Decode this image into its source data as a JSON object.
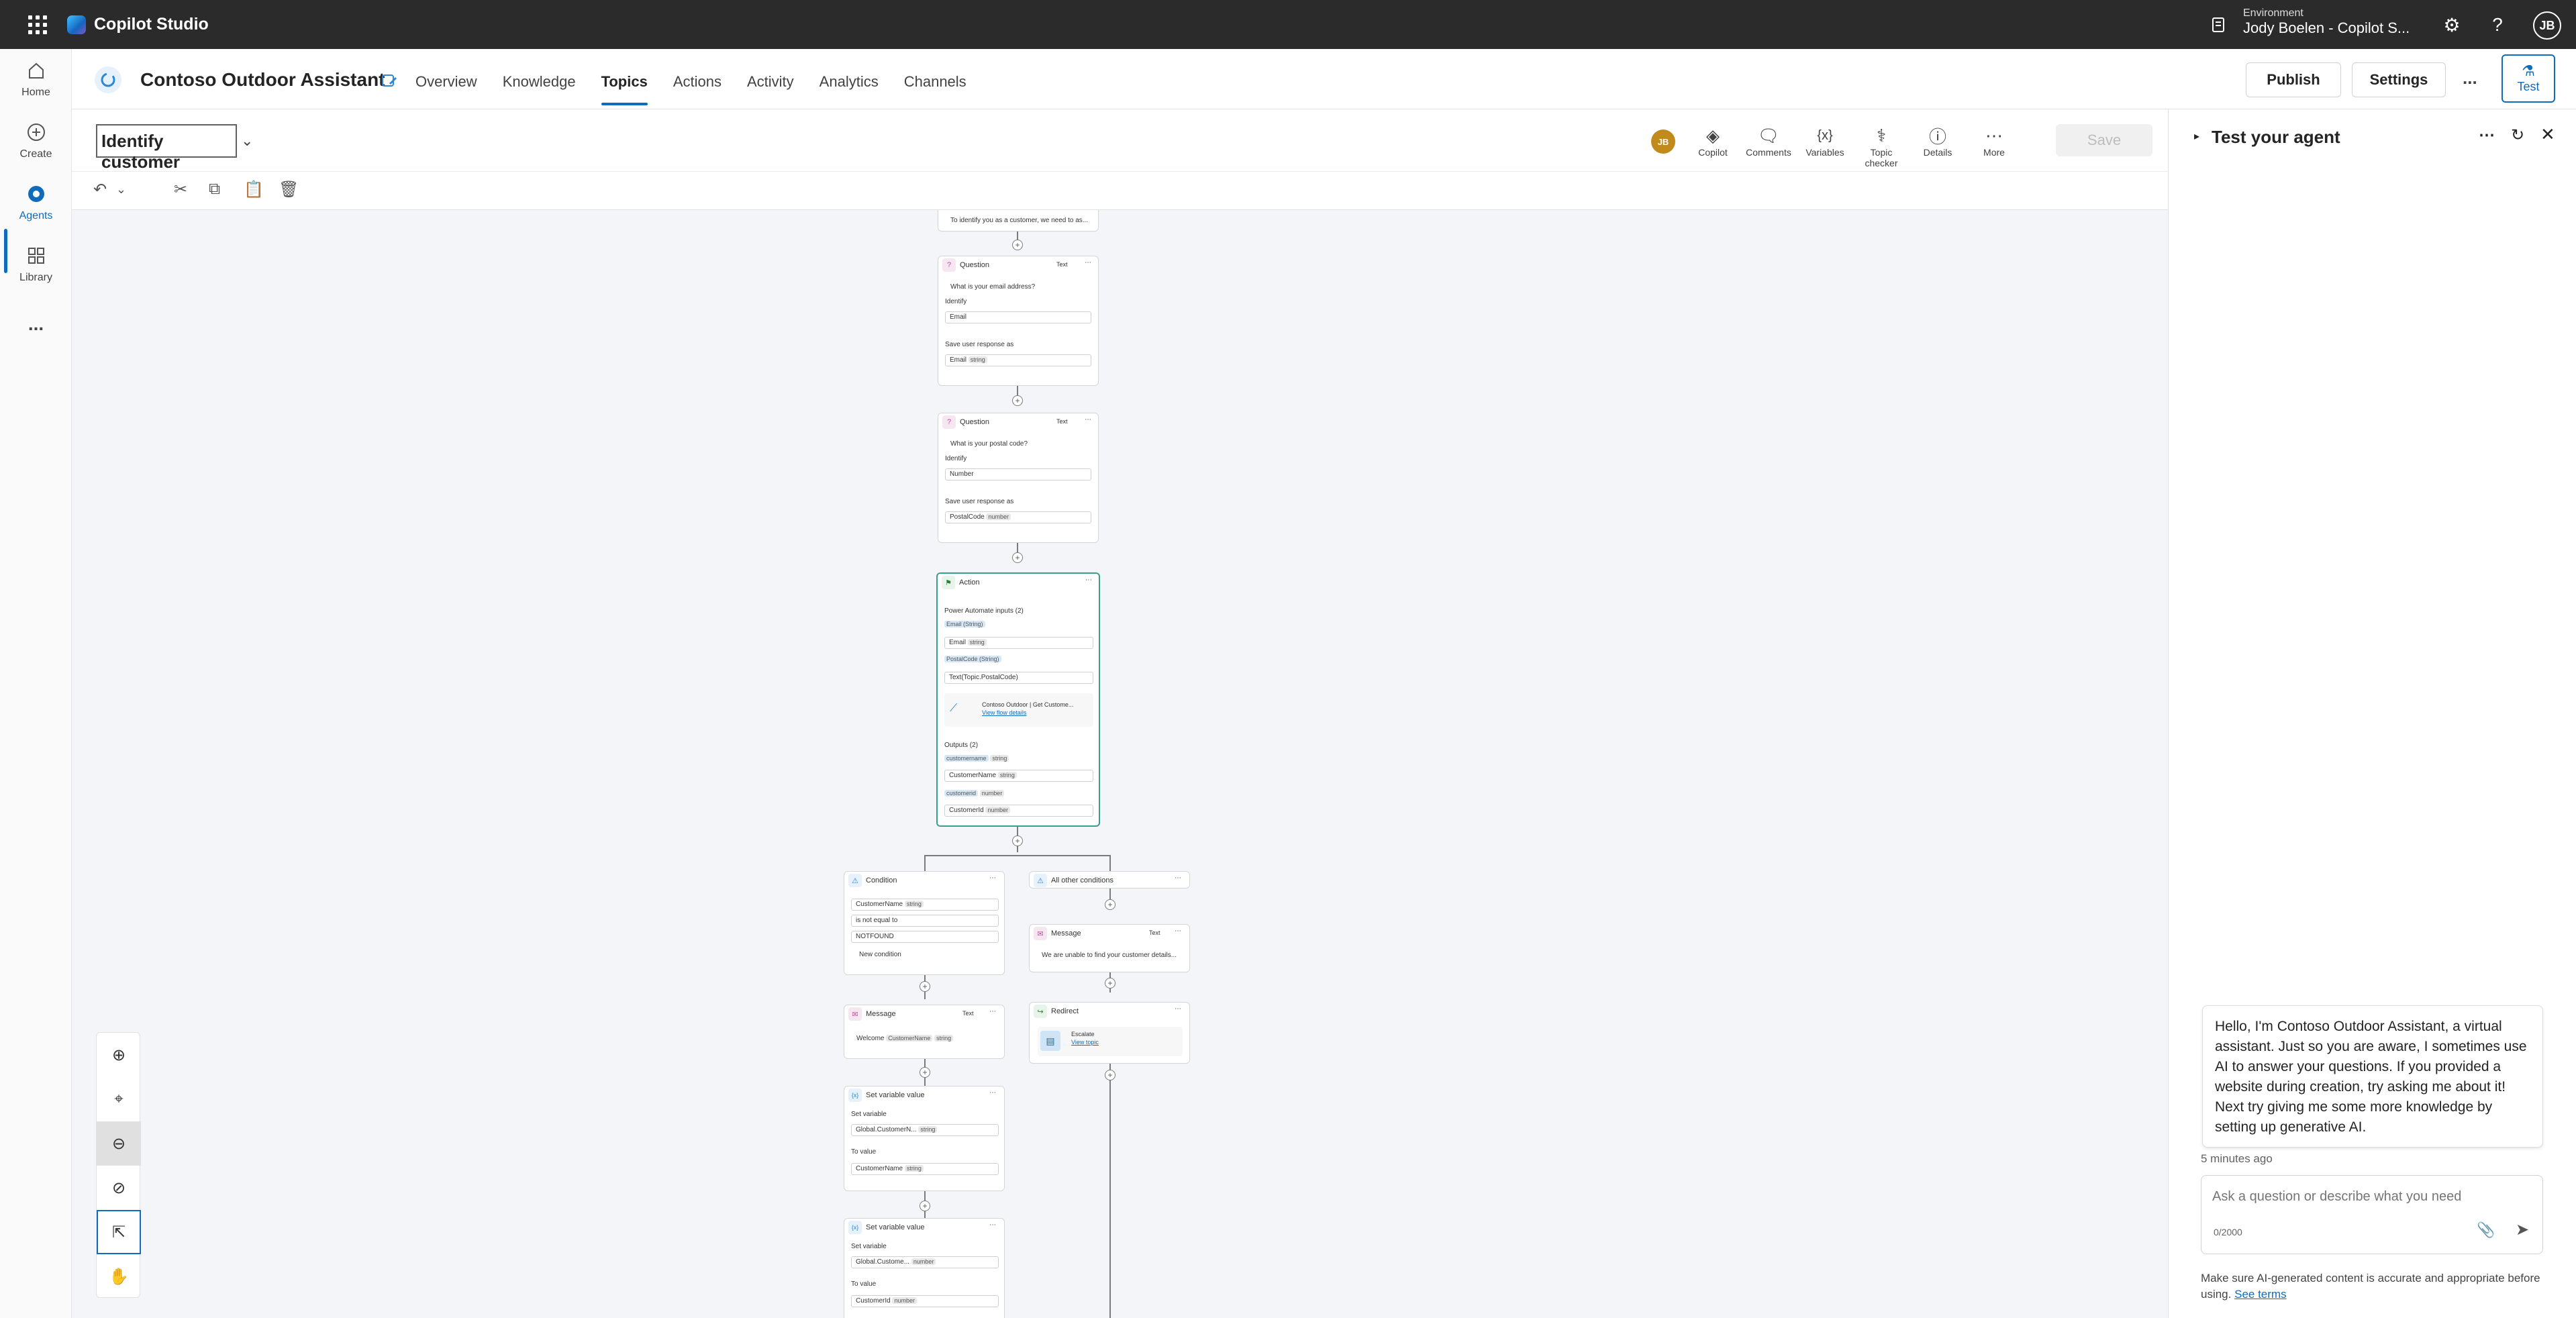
{
  "app": {
    "name": "Copilot Studio"
  },
  "environment": {
    "label": "Environment",
    "value": "Jody Boelen - Copilot S..."
  },
  "user": {
    "initials": "JB"
  },
  "rail": {
    "items": [
      {
        "label": "Home",
        "icon": "home-icon"
      },
      {
        "label": "Create",
        "icon": "plus-circle-icon"
      },
      {
        "label": "Agents",
        "icon": "agent-icon",
        "active": true
      },
      {
        "label": "Library",
        "icon": "library-icon"
      },
      {
        "label": "...",
        "icon": "more-icon"
      }
    ]
  },
  "agent": {
    "name": "Contoso Outdoor Assistant"
  },
  "nav": {
    "tabs": [
      "Overview",
      "Knowledge",
      "Topics",
      "Actions",
      "Activity",
      "Analytics",
      "Channels"
    ],
    "active": "Topics"
  },
  "header_buttons": {
    "publish": "Publish",
    "settings": "Settings",
    "more": "...",
    "test": "Test"
  },
  "topic": {
    "name": "Identify customer"
  },
  "toolbar": {
    "avatar": "JB",
    "copilot": "Copilot",
    "comments": "Comments",
    "variables": "Variables",
    "topic_checker": "Topic checker",
    "details": "Details",
    "more": "More",
    "save": "Save"
  },
  "flow": {
    "top_message": "To identify you as a customer, we need to as...",
    "q1": {
      "title": "Question",
      "mode": "Text",
      "prompt": "What is your email address?",
      "identify_label": "Identify",
      "identify": "Email",
      "save_label": "Save user response as",
      "var": "Email",
      "type": "string"
    },
    "q2": {
      "title": "Question",
      "mode": "Text",
      "prompt": "What is your postal code?",
      "identify_label": "Identify",
      "identify": "Number",
      "save_label": "Save user response as",
      "var": "PostalCode",
      "type": "number"
    },
    "action": {
      "title": "Action",
      "inputs_label": "Power Automate inputs (2)",
      "in1_name": "Email (String)",
      "in1_var": "Email",
      "in1_type": "string",
      "in2_name": "PostalCode (String)",
      "in2_formula": "Text(Topic.PostalCode)",
      "flow_name": "Contoso Outdoor | Get Custome...",
      "flow_link": "View flow details",
      "outputs_label": "Outputs (2)",
      "out1_name": "customername",
      "out1_type": "string",
      "out1_var": "CustomerName",
      "out1_vtype": "string",
      "out2_name": "customerid",
      "out2_type": "number",
      "out2_var": "CustomerId",
      "out2_vtype": "number"
    },
    "condition": {
      "title": "Condition",
      "var": "CustomerName",
      "type": "string",
      "op": "is not equal to",
      "value": "NOTFOUND",
      "new": "New condition"
    },
    "other": {
      "title": "All other conditions"
    },
    "msg_fail": {
      "title": "Message",
      "mode": "Text",
      "text": "We are unable to find your customer details..."
    },
    "redirect": {
      "title": "Redirect",
      "target": "Escalate",
      "link": "View topic"
    },
    "msg_ok": {
      "title": "Message",
      "mode": "Text",
      "text": "Welcome",
      "var": "CustomerName",
      "type": "string"
    },
    "set1": {
      "title": "Set variable value",
      "set_label": "Set variable",
      "var": "Global.CustomerN...",
      "type": "string",
      "to_label": "To value",
      "val": "CustomerName",
      "vtype": "string"
    },
    "set2": {
      "title": "Set variable value",
      "set_label": "Set variable",
      "var": "Global.Custome...",
      "type": "number",
      "to_label": "To value",
      "val": "CustomerId",
      "vtype": "number"
    }
  },
  "panel": {
    "title": "Test your agent",
    "greeting": "Hello, I'm Contoso Outdoor Assistant, a virtual assistant. Just so you are aware, I sometimes use AI to answer your questions. If you provided a website during creation, try asking me about it! Next try giving me some more knowledge by setting up generative AI.",
    "time": "5 minutes ago",
    "placeholder": "Ask a question or describe what you need",
    "counter": "0/2000",
    "disclaimer": "Make sure AI-generated content is accurate and appropriate before using.",
    "terms": "See terms"
  }
}
